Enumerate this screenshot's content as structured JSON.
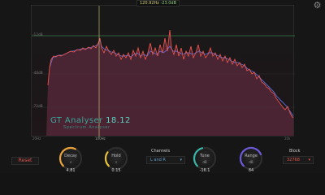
{
  "readout": {
    "frequency": "120.92Hz",
    "level": "-23.0dB"
  },
  "db_scale": {
    "top": "-12dB",
    "mid": "-48dB",
    "low": "-72dB"
  },
  "plugin": {
    "name": "GT Analyser",
    "version": "18.12",
    "subtitle": "Spectrum Analyser"
  },
  "freq_axis": {
    "marker": "100Hz",
    "left_tick": "20Hz",
    "right_tick": "20k"
  },
  "controls": {
    "reset_label": "Reset",
    "decay": {
      "label": "Decay",
      "unit": "s",
      "value": "4.81",
      "fill": 0.6,
      "color": "#e8a23a"
    },
    "hold": {
      "label": "Hold",
      "unit": "s",
      "value": "0.15",
      "fill": 0.3,
      "color": "#e8c23a"
    },
    "channels": {
      "label": "Channels",
      "value": "L and R"
    },
    "tune": {
      "label": "Tune",
      "unit": "dB",
      "value": "-16.1",
      "fill": 0.45,
      "color": "#3ab5a8"
    },
    "range": {
      "label": "Range",
      "unit": "dB",
      "value": "84",
      "fill": 0.75,
      "color": "#6a5ad8"
    },
    "block": {
      "label": "Block",
      "value": "32768"
    }
  },
  "colors": {
    "left_channel": "#e8534a",
    "right_channel": "#5a6ed8",
    "threshold_line": "#3fae5a",
    "marker_line": "#d8d27a"
  },
  "icons": {
    "settings": "gear-icon"
  }
}
